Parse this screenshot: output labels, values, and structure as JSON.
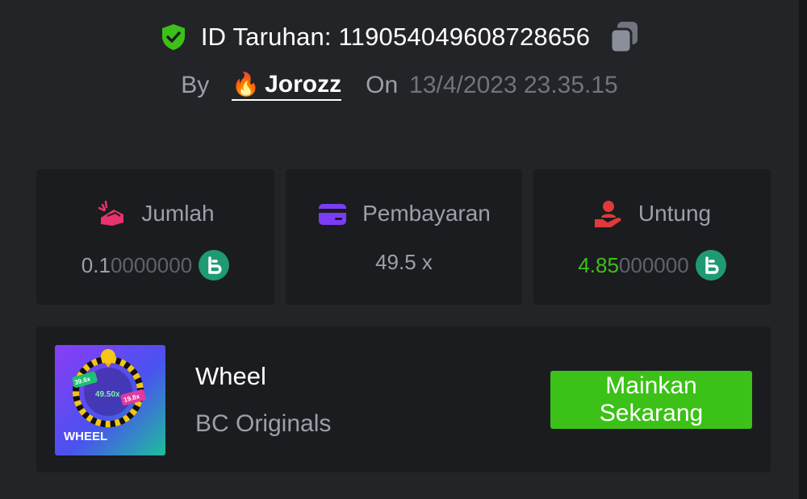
{
  "bet": {
    "id_label": "ID Taruhan: 119054049608728656",
    "by_label": "By",
    "user_emoji": "🔥",
    "username": "Jorozz",
    "on_label": "On",
    "date": "13/4/2023 23.35.15"
  },
  "stats": [
    {
      "title": "Jumlah",
      "value_main": "0.1",
      "value_dim": "0000000",
      "value_color": "#9aa0ab",
      "icon": "money-icon",
      "accent": "#e8336e"
    },
    {
      "title": "Pembayaran",
      "value_main": "49.5 x",
      "value_dim": "",
      "value_color": "#9aa0ab",
      "icon": "card-icon",
      "accent": "#7b3cf5"
    },
    {
      "title": "Untung",
      "value_main": "4.85",
      "value_dim": "000000",
      "value_color": "#3bc117",
      "icon": "profit-icon",
      "accent": "#e03a3a"
    }
  ],
  "game": {
    "name": "Wheel",
    "provider": "BC Originals",
    "thumb_title": "WHEEL",
    "thumb_tags": [
      "39.6x",
      "49.50x",
      "19.8x"
    ],
    "play_label_1": "Mainkan",
    "play_label_2": "Sekarang"
  },
  "colors": {
    "background": "#232427",
    "card": "#1b1c1f",
    "green": "#3bc117",
    "coin": "#1f9a74"
  }
}
